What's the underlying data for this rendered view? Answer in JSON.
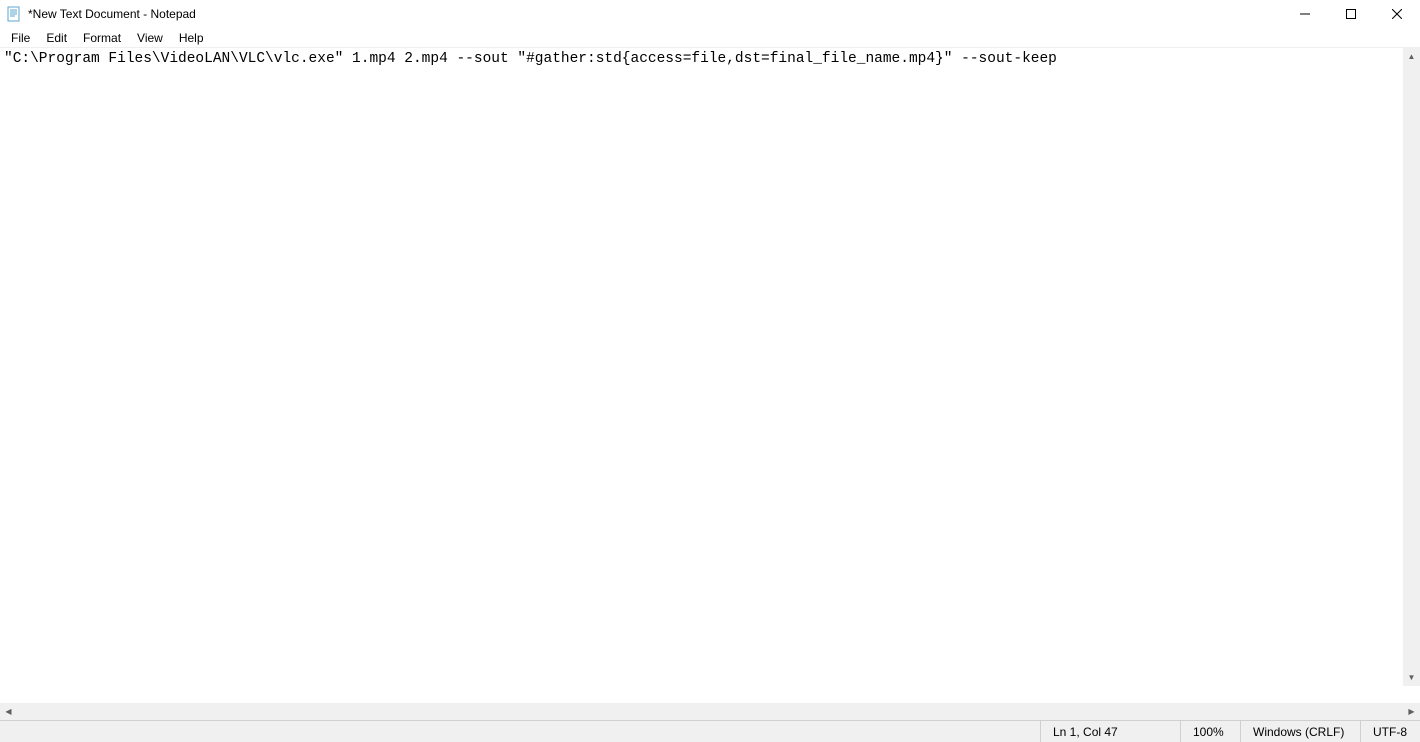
{
  "titlebar": {
    "title": "*New Text Document - Notepad"
  },
  "menubar": {
    "items": [
      "File",
      "Edit",
      "Format",
      "View",
      "Help"
    ]
  },
  "editor": {
    "content": "\"C:\\Program Files\\VideoLAN\\VLC\\vlc.exe\" 1.mp4 2.mp4 --sout \"#gather:std{access=file,dst=final_file_name.mp4}\" --sout-keep"
  },
  "statusbar": {
    "position": "Ln 1, Col 47",
    "zoom": "100%",
    "line_ending": "Windows (CRLF)",
    "encoding": "UTF-8"
  }
}
